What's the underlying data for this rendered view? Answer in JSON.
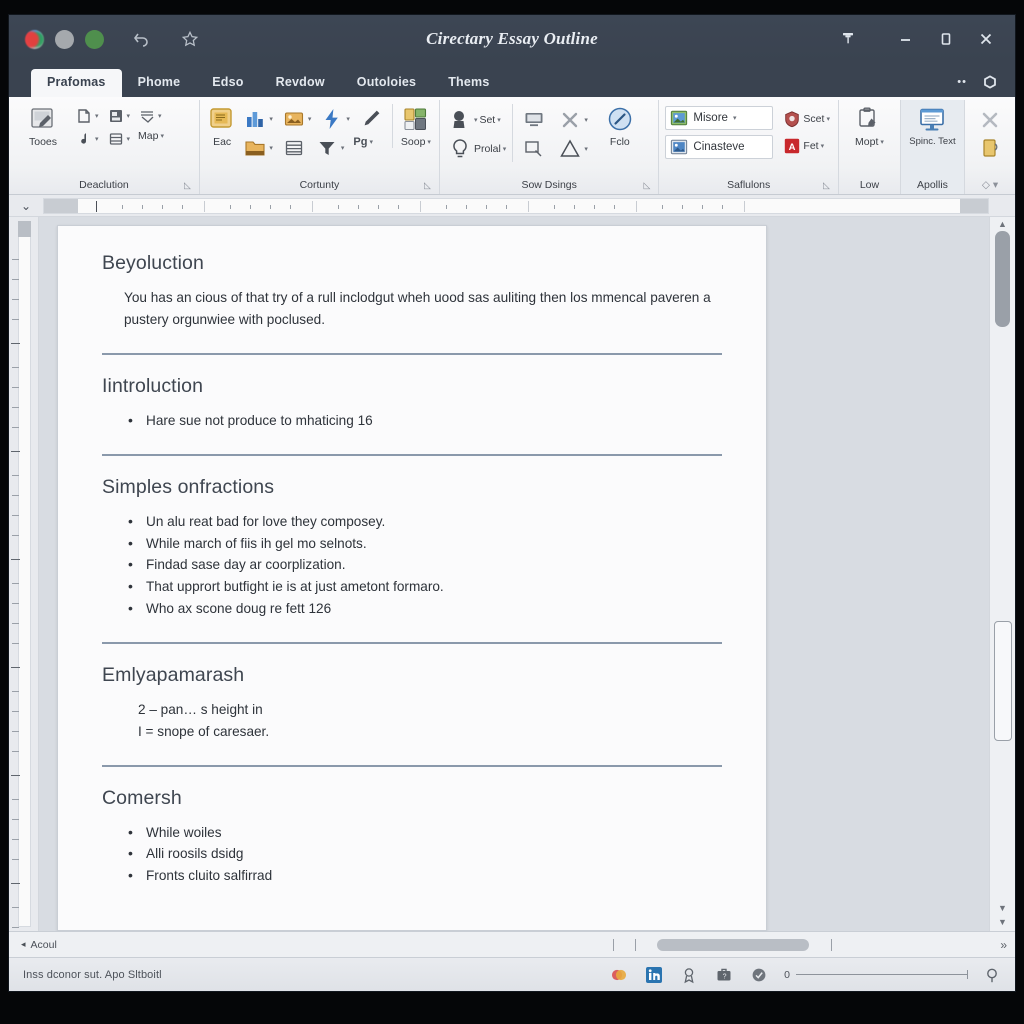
{
  "window": {
    "title": "Cirectary Essay Outline",
    "titlebar_icons": [
      "app-dot-multicolor",
      "dot-gray",
      "dot-green",
      "undo-icon",
      "star-icon"
    ],
    "controls": {
      "pin": "pin-icon",
      "minimize": "minimize-icon",
      "maximize": "maximize-icon",
      "close": "close-icon",
      "overflow": "more-options-icon",
      "help": "help-icon"
    }
  },
  "tabs": [
    {
      "label": "Prafomas",
      "active": true
    },
    {
      "label": "Phome",
      "active": false
    },
    {
      "label": "Edso",
      "active": false
    },
    {
      "label": "Revdow",
      "active": false
    },
    {
      "label": "Outoloies",
      "active": false
    },
    {
      "label": "Thems",
      "active": false
    }
  ],
  "ribbon": {
    "groups": [
      {
        "name": "Deaclution",
        "label": "Deaclution",
        "has_dialog_launcher": true,
        "big_buttons": [
          {
            "caption": "Tooes",
            "icon": "tools-icon"
          }
        ],
        "small_buttons": [
          {
            "caption": "",
            "icon": "page-icon",
            "caret": true
          },
          {
            "caption": "",
            "icon": "note-icon",
            "caret": true
          },
          {
            "caption": "",
            "icon": "layout-icon",
            "caret": true
          },
          {
            "caption": "",
            "icon": "music-icon",
            "caret": true
          },
          {
            "caption": "",
            "icon": "book-icon",
            "caret": true
          },
          {
            "caption": "Map",
            "icon": "map-icon",
            "caret": true
          }
        ]
      },
      {
        "name": "Cortunty",
        "label": "Cortunty",
        "has_dialog_launcher": true,
        "big_buttons": [
          {
            "caption": "Eac",
            "icon": "grid-icon"
          }
        ],
        "small_buttons": [
          {
            "caption": "",
            "icon": "chart-icon",
            "caret": true
          },
          {
            "caption": "",
            "icon": "image-icon",
            "caret": true
          },
          {
            "caption": "",
            "icon": "lightning-icon",
            "caret": true
          },
          {
            "caption": "",
            "icon": "pen-icon",
            "caret": false
          },
          {
            "caption": "",
            "icon": "folder-icon",
            "caret": true
          },
          {
            "caption": "",
            "icon": "table-icon",
            "caret": false
          },
          {
            "caption": "",
            "icon": "filter-icon",
            "caret": true
          },
          {
            "caption": "Pg",
            "icon": "text-icon",
            "caret": true
          },
          {
            "caption": "Soop",
            "icon": "shapes-icon",
            "caret": true
          }
        ]
      },
      {
        "name": "Sow Dsings",
        "label": "Sow Dsings",
        "has_dialog_launcher": true,
        "big_buttons": [
          {
            "caption": "Fclo",
            "icon": "compass-icon"
          }
        ],
        "small_buttons": [
          {
            "caption": "Set",
            "icon": "stamp-icon",
            "caret": true
          },
          {
            "caption": "Prolal",
            "icon": "bulb-icon",
            "caret": true
          },
          {
            "caption": "",
            "icon": "monitor-icon",
            "caret": false
          },
          {
            "caption": "",
            "icon": "close-x-icon",
            "caret": true
          },
          {
            "caption": "",
            "icon": "zoom-icon",
            "caret": false
          },
          {
            "caption": "",
            "icon": "triangle-icon",
            "caret": true
          }
        ]
      },
      {
        "name": "Saflulons",
        "label": "Saflulons",
        "has_dialog_launcher": true,
        "gallery": [
          {
            "caption": "Misore",
            "icon": "photo-green-icon",
            "caret": true
          },
          {
            "caption": "Cinasteve",
            "icon": "photo-blue-icon",
            "caret": false
          }
        ],
        "small_buttons": [
          {
            "caption": "Scet",
            "icon": "shield-icon",
            "caret": true
          },
          {
            "caption": "Fet",
            "icon": "pdf-icon",
            "caret": true
          }
        ]
      },
      {
        "name": "Low",
        "label": "Low",
        "has_dialog_launcher": false,
        "small_buttons": [
          {
            "caption": "Mopt",
            "icon": "clipboard-edit-icon",
            "caret": true
          }
        ]
      },
      {
        "name": "Apollis",
        "label": "Apollis",
        "has_dialog_launcher": false,
        "big_buttons": [
          {
            "caption": "Spinc. Text",
            "icon": "screen-icon"
          }
        ]
      },
      {
        "name": "",
        "label": "",
        "has_dialog_launcher": false,
        "small_buttons": [
          {
            "caption": "",
            "icon": "close-x-icon",
            "caret": false
          },
          {
            "caption": "",
            "icon": "book-yellow-icon",
            "caret": false
          }
        ]
      }
    ]
  },
  "document": {
    "sections": [
      {
        "heading": "Beyoluction",
        "type": "paragraph",
        "paragraph": "You has an cious of that try of a rull inclodgut wheh uood sas auliting then los mmencal paveren a pustery orgunwiee with poclused.",
        "rule_after": true
      },
      {
        "heading": "Iintroluction",
        "type": "bullets",
        "bullets": [
          "Hare sue not produce to mhaticing 16"
        ],
        "rule_after": true
      },
      {
        "heading": "Simples onfractions",
        "type": "bullets",
        "bullets": [
          "Un alu reat bad for love they composey.",
          "While march of fiis ih gel mo selnots.",
          "Findad sase day ar coorplization.",
          "That upprort butfight ie is at just ametont formaro.",
          "Who ax scone doug re fett 126"
        ],
        "rule_after": true
      },
      {
        "heading": "Emlyapamarash",
        "type": "plain",
        "lines": [
          "2 – pan… s height in",
          "I = snope of caresaer."
        ],
        "rule_after": true
      },
      {
        "heading": "Comersh",
        "type": "bullets",
        "bullets": [
          "While woiles",
          "Alli roosils dsidg",
          "Fronts cluito salfirrad"
        ],
        "rule_after": false
      }
    ]
  },
  "hscroll": {
    "left_label": "Acoul",
    "right_icon": "expand-right-icon"
  },
  "statusbar": {
    "text": "Inss dconor sut. Apo Sltboitl",
    "icons": [
      "mastercard-icon",
      "linkedin-icon",
      "award-icon",
      "briefcase-icon",
      "shield-gray-icon"
    ],
    "zoom_value": "0",
    "zoom_icon": "magnifier-icon"
  },
  "colors": {
    "chrome": "#3a4350",
    "ribbon_bg": "#f1f2f4",
    "page_bg": "#fbfbfc",
    "accent_blue": "#3b79c4",
    "accent_gold": "#e0b23c",
    "accent_red": "#c8282c",
    "rule": "#8a99ab"
  }
}
